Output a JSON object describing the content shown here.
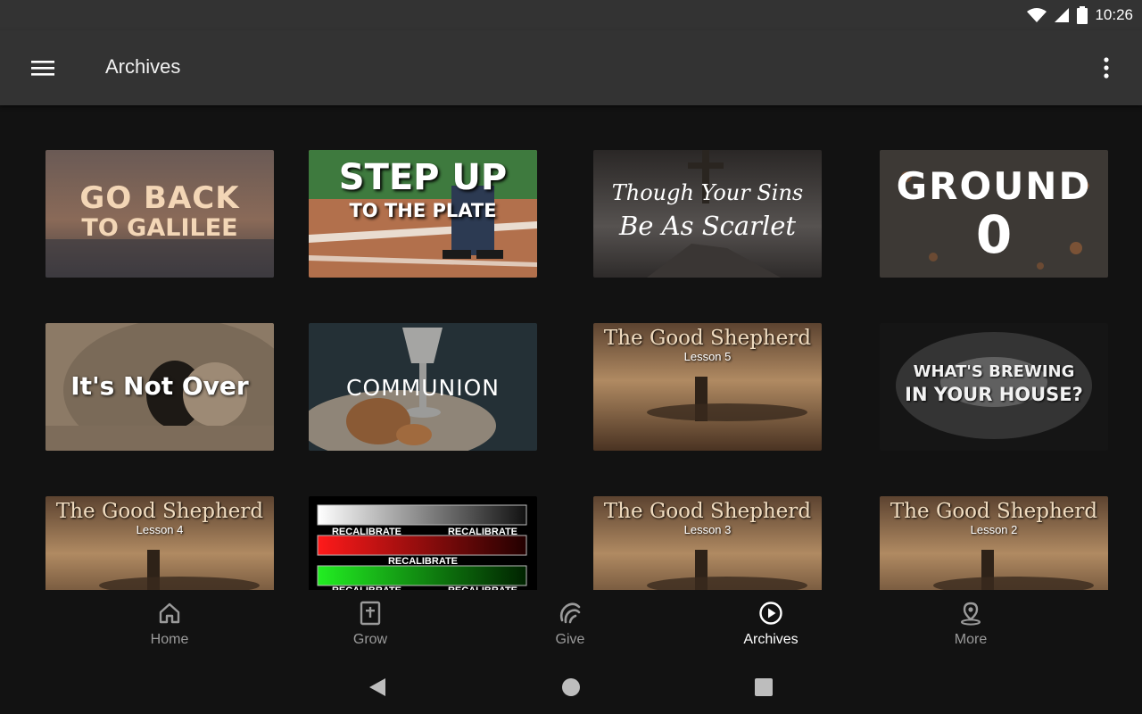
{
  "status_bar": {
    "time": "10:26"
  },
  "app_bar": {
    "title": "Archives"
  },
  "tiles": [
    {
      "name": "tile-go-back-to-galilee",
      "line1": "GO BACK",
      "line2": "TO GALILEE"
    },
    {
      "name": "tile-step-up-to-the-plate",
      "line1": "STEP UP",
      "line2": "TO THE PLATE"
    },
    {
      "name": "tile-though-your-sins",
      "line1": "Though Your Sins",
      "line2": "Be As Scarlet"
    },
    {
      "name": "tile-ground-0",
      "line1": "GROUND",
      "line2": "0"
    },
    {
      "name": "tile-its-not-over",
      "line1": "It's Not Over"
    },
    {
      "name": "tile-communion",
      "line1": "COMMUNION"
    },
    {
      "name": "tile-good-shepherd-5",
      "line1": "The Good Shepherd",
      "line2": "Lesson 5"
    },
    {
      "name": "tile-whats-brewing",
      "line1": "WHAT'S BREWING",
      "line2": "IN YOUR HOUSE?"
    },
    {
      "name": "tile-good-shepherd-4",
      "line1": "The Good Shepherd",
      "line2": "Lesson 4"
    },
    {
      "name": "tile-recalibrate",
      "line1": "RECALIBRATE"
    },
    {
      "name": "tile-good-shepherd-3",
      "line1": "The Good Shepherd",
      "line2": "Lesson 3"
    },
    {
      "name": "tile-good-shepherd-2",
      "line1": "The Good Shepherd",
      "line2": "Lesson 2"
    }
  ],
  "bottom_nav": [
    {
      "label": "Home",
      "icon": "home-icon"
    },
    {
      "label": "Grow",
      "icon": "bible-icon"
    },
    {
      "label": "Give",
      "icon": "give-icon"
    },
    {
      "label": "Archives",
      "icon": "play-circle-icon",
      "active": true
    },
    {
      "label": "More",
      "icon": "location-pin-icon"
    }
  ],
  "colors": {
    "bar": "#333333",
    "background": "#121212",
    "nav_inactive": "#9a9a9a",
    "nav_active": "#ffffff"
  }
}
